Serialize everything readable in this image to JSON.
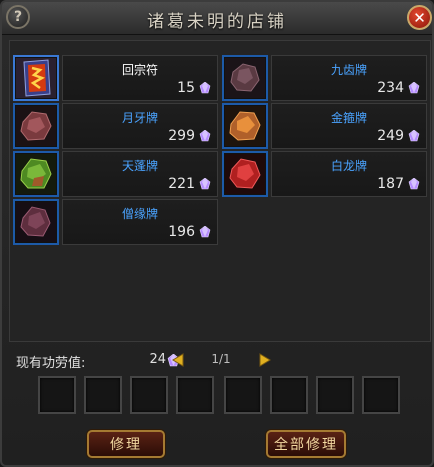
{
  "window": {
    "title": "诸葛未明的店铺",
    "help_glyph": "?",
    "close_glyph": "✕"
  },
  "colors": {
    "item_name_blue": "#4aa3ff",
    "item_name_white": "#ffffff",
    "button_border": "#a57a32",
    "gem_purple": "#b58cff"
  },
  "items": [
    {
      "name": "回宗符",
      "price": "15",
      "icon": "talisman-icon",
      "name_color": "white"
    },
    {
      "name": "九齿牌",
      "price": "234",
      "icon": "dark-ore-icon",
      "name_color": "blue"
    },
    {
      "name": "月牙牌",
      "price": "299",
      "icon": "red-ore-icon",
      "name_color": "blue"
    },
    {
      "name": "金箍牌",
      "price": "249",
      "icon": "gold-ore-icon",
      "name_color": "blue"
    },
    {
      "name": "天蓬牌",
      "price": "221",
      "icon": "green-ore-icon",
      "name_color": "blue"
    },
    {
      "name": "白龙牌",
      "price": "187",
      "icon": "crimson-ore-icon",
      "name_color": "blue"
    },
    {
      "name": "僧缘牌",
      "price": "196",
      "icon": "purple-ore-icon",
      "name_color": "blue"
    }
  ],
  "merit": {
    "label": "现有功劳值:",
    "value": "24"
  },
  "pagination": {
    "page": "1/1"
  },
  "buttons": {
    "repair": "修理",
    "repair_all": "全部修理"
  }
}
